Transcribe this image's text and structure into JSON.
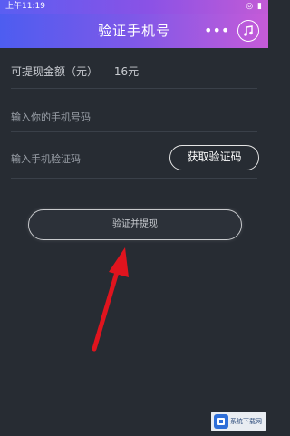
{
  "status_bar": {
    "time": "上午11:19",
    "right_icons": "◎ ▮"
  },
  "nav": {
    "title": "验证手机号",
    "more_icon": "•••",
    "music_icon": "music-icon"
  },
  "form": {
    "balance_label": "可提现金额（元）",
    "balance_value": "16元",
    "phone_placeholder": "输入你的手机号码",
    "code_placeholder": "输入手机验证码",
    "get_code_label": "获取验证码",
    "verify_label": "验证并提现"
  },
  "watermark": {
    "text": "系统下载网"
  },
  "colors": {
    "background": "#272c33",
    "accent_start": "#4d5df0",
    "accent_end": "#c65bd8",
    "arrow": "#e0141e"
  }
}
